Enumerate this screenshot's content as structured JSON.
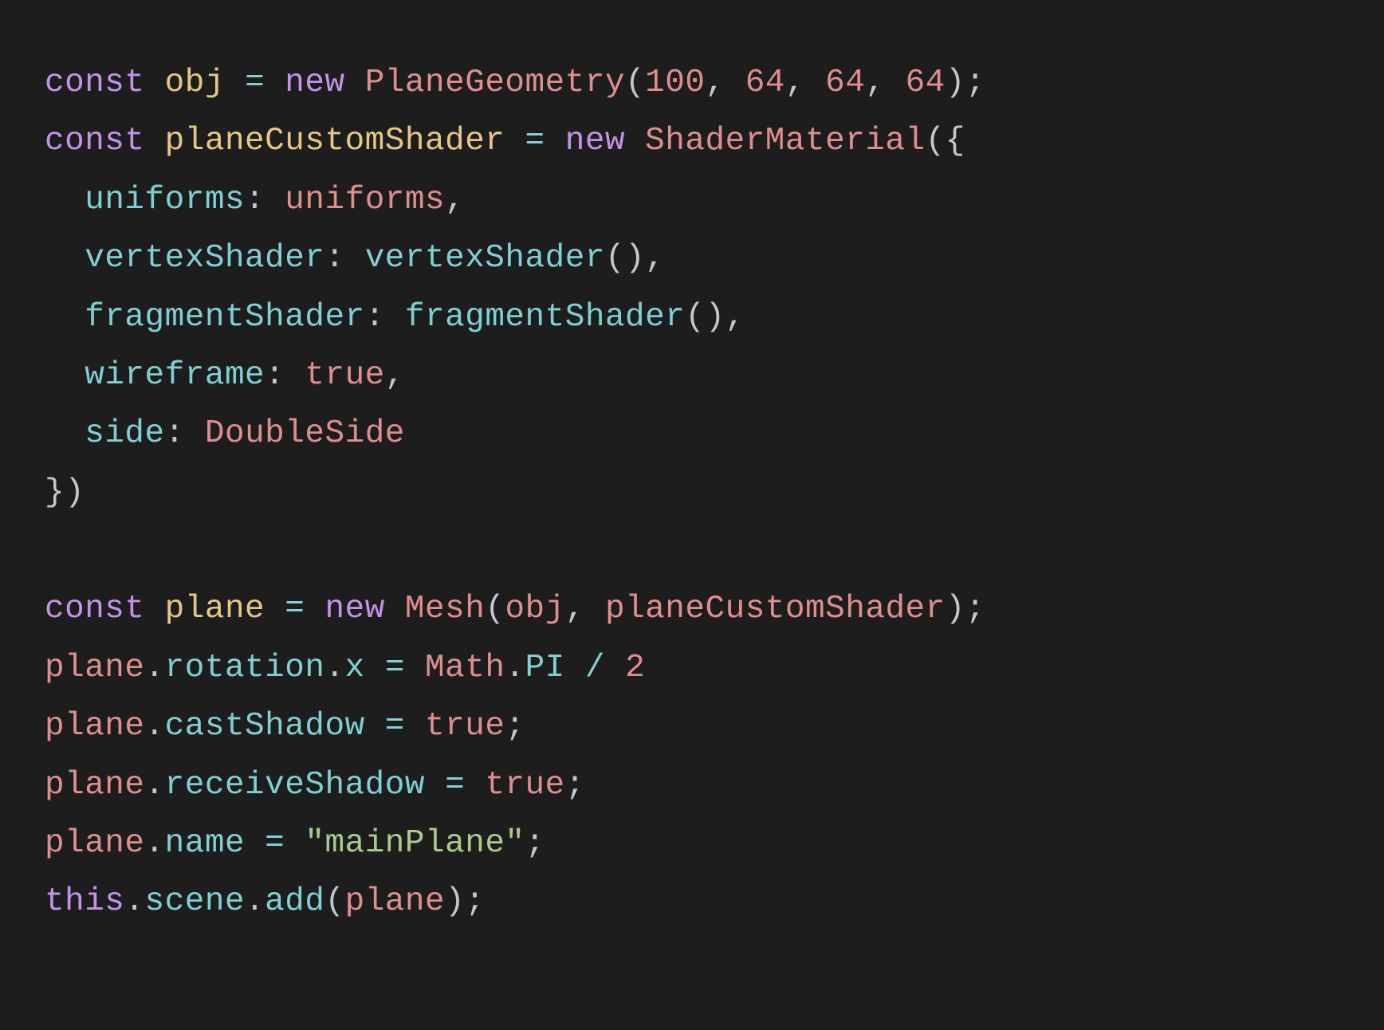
{
  "code": {
    "kw_const": "const",
    "kw_new": "new",
    "kw_this": "this",
    "var_obj": "obj",
    "var_planeCustomShader": "planeCustomShader",
    "var_plane": "plane",
    "cls_PlaneGeometry": "PlaneGeometry",
    "cls_ShaderMaterial": "ShaderMaterial",
    "cls_Mesh": "Mesh",
    "cls_Math": "Math",
    "num_100": "100",
    "num_64a": "64",
    "num_64b": "64",
    "num_64c": "64",
    "num_2": "2",
    "prop_uniforms": "uniforms",
    "prop_vertexShader": "vertexShader",
    "prop_fragmentShader": "fragmentShader",
    "prop_wireframe": "wireframe",
    "prop_side": "side",
    "prop_rotation": "rotation",
    "prop_x": "x",
    "prop_castShadow": "castShadow",
    "prop_receiveShadow": "receiveShadow",
    "prop_name": "name",
    "prop_scene": "scene",
    "prop_PI": "PI",
    "id_uniforms": "uniforms",
    "id_DoubleSide": "DoubleSide",
    "id_obj_ref": "obj",
    "id_planeCustomShader_ref": "planeCustomShader",
    "id_plane_ref1": "plane",
    "id_plane_ref2": "plane",
    "id_plane_ref3": "plane",
    "id_plane_ref4": "plane",
    "id_plane_ref5": "plane",
    "fn_vertexShader": "vertexShader",
    "fn_fragmentShader": "fragmentShader",
    "fn_add": "add",
    "bool_true1": "true",
    "bool_true2": "true",
    "bool_true3": "true",
    "str_mainPlane": "\"mainPlane\"",
    "op_eq": "=",
    "op_div": "/",
    "p_lparen": "(",
    "p_rparen": ")",
    "p_lbrace": "{",
    "p_rbrace": "}",
    "p_comma": ",",
    "p_colon": ":",
    "p_semi": ";",
    "p_dot": "."
  }
}
